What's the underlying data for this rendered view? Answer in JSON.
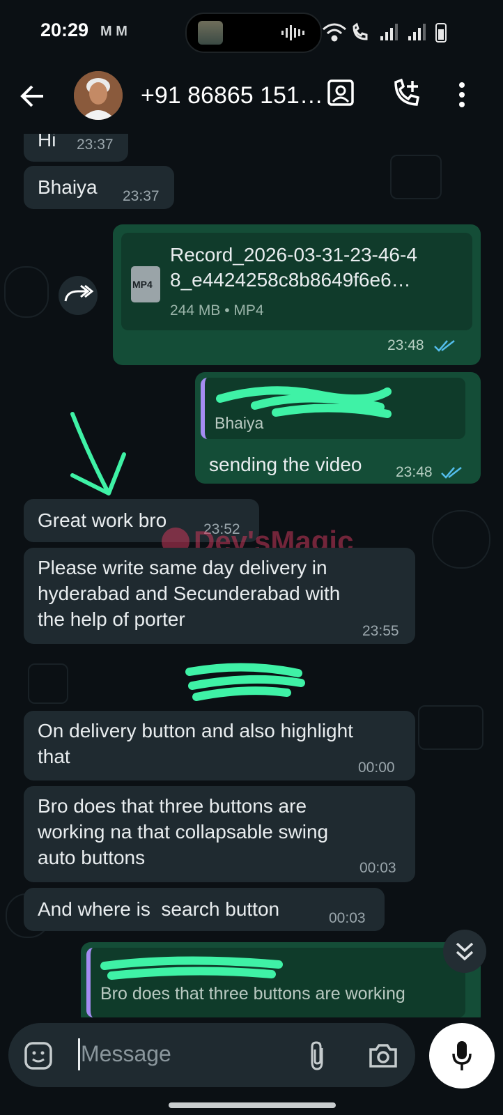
{
  "status_bar": {
    "time": "20:29",
    "indicators": "M M",
    "icons": [
      "video-thumbnail-icon",
      "audio-wave-icon",
      "wifi-icon",
      "wifi-calling-icon",
      "signal-icon",
      "signal-icon",
      "battery-icon"
    ]
  },
  "header": {
    "contact": "+91 86865 151…",
    "icons": [
      "back-arrow-icon",
      "contact-card-icon",
      "add-call-icon",
      "more-vert-icon"
    ]
  },
  "messages": [
    {
      "dir": "in",
      "text": "Hi",
      "time": "23:37"
    },
    {
      "dir": "in",
      "text": "Bhaiya",
      "time": "23:37"
    },
    {
      "dir": "out",
      "type": "file",
      "file_name_line1": "Record_2026-03-31-23-46-4",
      "file_name_line2": "8_e4424258c8b8649f6e6…",
      "file_badge": "MP4",
      "file_meta": "244 MB • MP4",
      "time": "23:48"
    },
    {
      "dir": "out",
      "type": "reply",
      "quote_text": "Bhaiya",
      "text": "sending the video",
      "time": "23:48"
    },
    {
      "dir": "in",
      "text": "Great work bro",
      "time": "23:52"
    },
    {
      "dir": "in",
      "line1": "Please write same day delivery in",
      "line2": "hyderabad and Secunderabad with",
      "line3": "the help of porter",
      "time": "23:55"
    },
    {
      "dir": "in",
      "line1": "On delivery button and also highlight",
      "line2": "that",
      "time": "00:00"
    },
    {
      "dir": "in",
      "line1": "Bro does that three buttons are",
      "line2": "working na that collapsable swing",
      "line3": "auto buttons",
      "time": "00:03"
    },
    {
      "dir": "in",
      "text": "And where is  search button",
      "time": "00:03"
    },
    {
      "dir": "out",
      "type": "reply-partial",
      "quote_text": "Bro does that three buttons are working"
    }
  ],
  "watermark": "Dev'sMagic",
  "composer": {
    "placeholder": "Message",
    "icons": [
      "sticker-icon",
      "attach-icon",
      "camera-icon",
      "mic-icon"
    ]
  },
  "colors": {
    "background": "#0b1014",
    "incoming_bubble": "#1f2a30",
    "outgoing_bubble": "#144d37",
    "read_ticks": "#53bdeb",
    "annotation": "#3ff2a6"
  }
}
